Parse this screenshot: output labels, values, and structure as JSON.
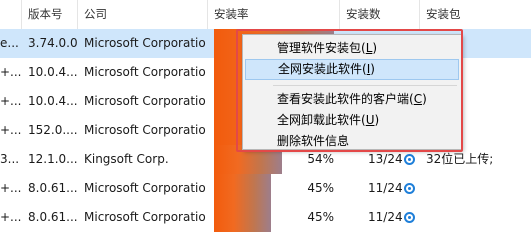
{
  "headers": [
    "",
    "版本号",
    "公司",
    "安装率",
    "安装数",
    "安装包"
  ],
  "rows": [
    {
      "mark": "e...",
      "version": "3.74.0.0",
      "company": "Microsoft Corporatio",
      "rate": "",
      "count": "",
      "pkg": "",
      "fill": 0.95,
      "selected": true
    },
    {
      "mark": "+...",
      "version": "10.0.4...",
      "company": "Microsoft Corporatio",
      "rate": "",
      "count": "",
      "pkg": "",
      "fill": 0.95
    },
    {
      "mark": "+...",
      "version": "10.0.4...",
      "company": "Microsoft Corporatio",
      "rate": "",
      "count": "",
      "pkg": "",
      "fill": 0.95
    },
    {
      "mark": "+...",
      "version": "152.0....",
      "company": "Microsoft Corporatio",
      "rate": "",
      "count": "",
      "pkg": "",
      "fill": 0.95
    },
    {
      "mark": "3...",
      "version": "12.1.0....",
      "company": "Kingsoft Corp.",
      "rate": "54%",
      "count": "13/24",
      "pkg": "32位已上传;",
      "fill": 0.54
    },
    {
      "mark": "+...",
      "version": "8.0.61...",
      "company": "Microsoft Corporatio",
      "rate": "45%",
      "count": "11/24",
      "pkg": "",
      "fill": 0.45
    },
    {
      "mark": "+...",
      "version": "8.0.61...",
      "company": "Microsoft Corporatio",
      "rate": "45%",
      "count": "11/24",
      "pkg": "",
      "fill": 0.45
    }
  ],
  "menu": {
    "items": [
      {
        "label": "管理软件安装包(",
        "key": "L",
        "tail": ")"
      },
      {
        "label": "全网安装此软件(",
        "key": "I",
        "tail": ")"
      },
      {
        "label": "查看安装此软件的客户端(",
        "key": "C",
        "tail": ")"
      },
      {
        "label": "全网卸载此软件(",
        "key": "U",
        "tail": ")"
      },
      {
        "label": "删除软件信息",
        "key": "",
        "tail": ""
      }
    ]
  },
  "colors": {
    "accent": "#1e7fd9",
    "bar": "#f25b0c",
    "highlight": "#e34848",
    "selected_row": "#cfe6fb"
  }
}
